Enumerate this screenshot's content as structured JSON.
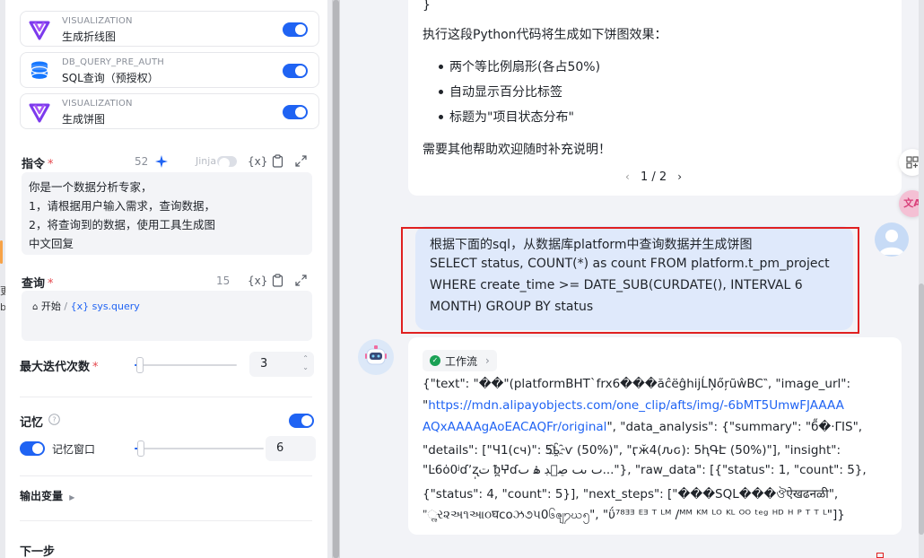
{
  "tools": [
    {
      "type": "VISUALIZATION",
      "name": "生成折线图",
      "enabled": true,
      "icon": "visualization-icon"
    },
    {
      "type": "DB_QUERY_PRE_AUTH",
      "name": "SQL查询（预授权）",
      "enabled": true,
      "icon": "database-icon"
    },
    {
      "type": "VISUALIZATION",
      "name": "生成饼图",
      "enabled": true,
      "icon": "visualization-icon"
    }
  ],
  "instruction": {
    "label": "指令",
    "required_mark": "*",
    "count": "52",
    "jinja_label": "Jinja",
    "var_label": "{x}",
    "lines": [
      "你是一个数据分析专家，",
      "1，请根据用户输入需求，查询数据，",
      "2，将查询到的数据，使用工具生成图",
      "中文回复"
    ]
  },
  "query": {
    "label": "查询",
    "required_mark": "*",
    "count": "15",
    "var_label": "{x}",
    "chip_start": "开始",
    "chip_sep": "/",
    "chip_var": "{x} sys.query"
  },
  "max_iterations": {
    "label": "最大迭代次数",
    "required_mark": "*",
    "value": "3",
    "fraction": 0.05
  },
  "memory": {
    "label": "记忆",
    "enabled": true,
    "window_label": "记忆窗口",
    "window_enabled": true,
    "window_value": "6",
    "fraction": 0.05
  },
  "output_vars_label": "输出变量",
  "next_step_label": "下一步",
  "edge_glyphs": [
    "更",
    "b"
  ],
  "ai_message": {
    "code_tail": "}",
    "intro": "执行这段Python代码将生成如下饼图效果：",
    "bullets": [
      "两个等比例扇形(各占50%)",
      "自动显示百分比标签",
      "标题为\"项目状态分布\""
    ],
    "closing": "需要其他帮助欢迎随时补充说明！",
    "pager": "1 / 2"
  },
  "user_message": {
    "lines": [
      "根据下面的sql，从数据库platform中查询数据并生成饼图",
      "SELECT status, COUNT(*) as count FROM platform.t_pm_project",
      "WHERE create_time >= DATE_SUB(CURDATE(), INTERVAL 6",
      "MONTH) GROUP BY status"
    ]
  },
  "workflow_reply": {
    "tag": "工作流",
    "json_lines": [
      {
        "pre": "{\"text\": \"��\"(platformBHT`frx6���ăĉëĝhijĹŅőŗũŵBC‶, \"image_url\":",
        "link": "",
        "post": ""
      },
      {
        "pre": "\"",
        "link": "https://mdn.alipayobjects.com/one_clip/afts/img/-6bMT5UmwFJAAAA",
        "post": ""
      },
      {
        "pre": "",
        "link": "AQxAAAAgAoEACAQFr/original",
        "post": "\", \"data_analysis\": {\"summary\": \"б̋�·ΓIS\","
      },
      {
        "pre": "\"details\": [\"Ч1(сч)\": 5ҍ҈ѵ (50%)\", \"ӷӂ4(ԉԍ): 5ԧԳԷ (50%)\"], \"insight\":",
        "link": "",
        "post": ""
      },
      {
        "pre": "\"Ŀ6ȯ0ʲɗʼʐ̩ت ᵬ̪ⵖ̄ɗٮ ٮٮ ڝۘڊ ۿ ٮ...\"}, \"raw_data\": [{\"status\": 1, \"count\": 5},",
        "link": "",
        "post": ""
      },
      {
        "pre": "{\"status\": 4, \"count\": 5}], \"next_steps\": [\"���SQL���ঔऐखढनळी\",",
        "link": "",
        "post": ""
      },
      {
        "pre": "\"ૢર૨અ૧આ૦घcoઝ૭૫0၆ၛ႒ဃ၅\", \"ΰ⁷⁸ᴲᴲ ᴱᴲ ᵀ ᴸᴹ /ᴹᴹ ᴷᴹ ᴸᴼ ᴷᴸ ᴼᴼ ᵗᵉᵍ ᴴᴰ ᴴ ᴾ ᵀ ᵀ ᴸ\"]}",
        "link": "",
        "post": ""
      }
    ]
  },
  "side_tools": [
    {
      "icon": "layout-icon"
    },
    {
      "icon": "translate-icon",
      "text": "文A"
    }
  ],
  "colors": {
    "accent": "#1f63f3",
    "highlight": "#e02020",
    "user_bubble": "#dfe9fb"
  }
}
